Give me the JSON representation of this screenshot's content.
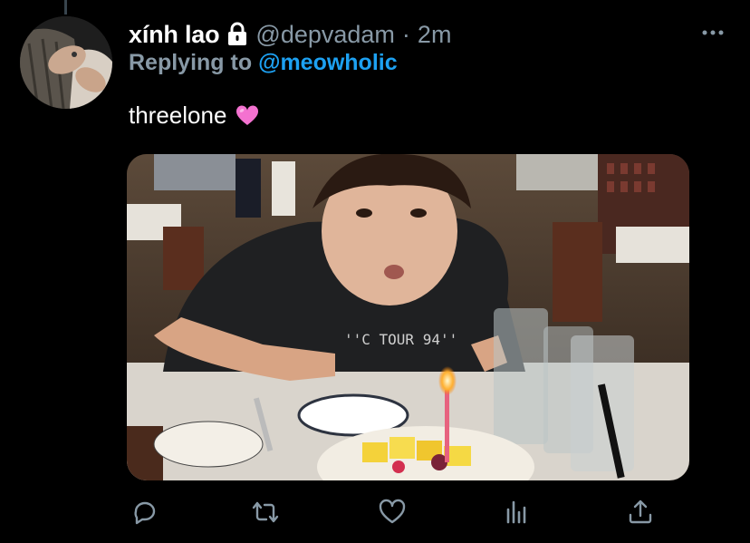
{
  "tweet": {
    "display_name": "xính lao",
    "handle": "@depvadam",
    "separator": "·",
    "time": "2m",
    "replying_prefix": "Replying to",
    "replying_to": "@meowholic",
    "text": "threelone",
    "emoji": "pink-heart-icon",
    "locked": true
  },
  "actions": [
    "reply-icon",
    "retweet-icon",
    "like-icon",
    "analytics-icon",
    "share-icon"
  ],
  "colors": {
    "background": "#000000",
    "secondary_text": "#8899a6",
    "link": "#1da1f2",
    "primary_text": "#ffffff"
  }
}
